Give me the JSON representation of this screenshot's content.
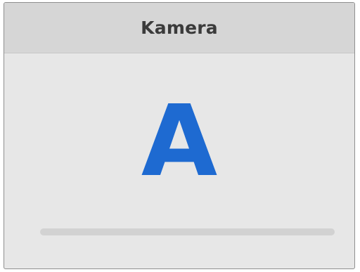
{
  "panel": {
    "title": "Kamera",
    "camera_letter": "A",
    "accent_color": "#1e6ad1",
    "progress": {
      "value_percent": 0
    }
  }
}
